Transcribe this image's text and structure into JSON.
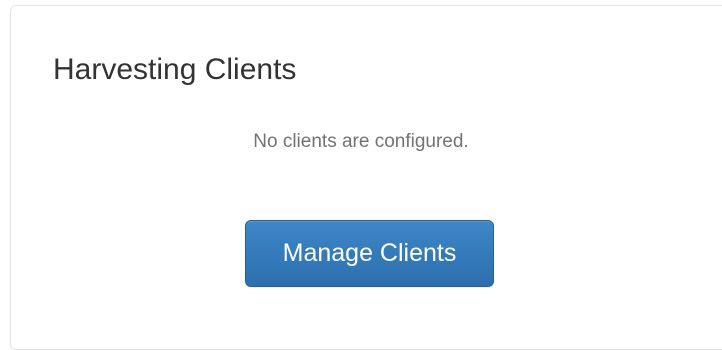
{
  "panel": {
    "title": "Harvesting Clients",
    "empty_message": "No clients are configured.",
    "manage_button_label": "Manage Clients"
  },
  "colors": {
    "button_background": "#337ab7",
    "button_text": "#ffffff",
    "title_text": "#333333",
    "message_text": "#737373"
  }
}
